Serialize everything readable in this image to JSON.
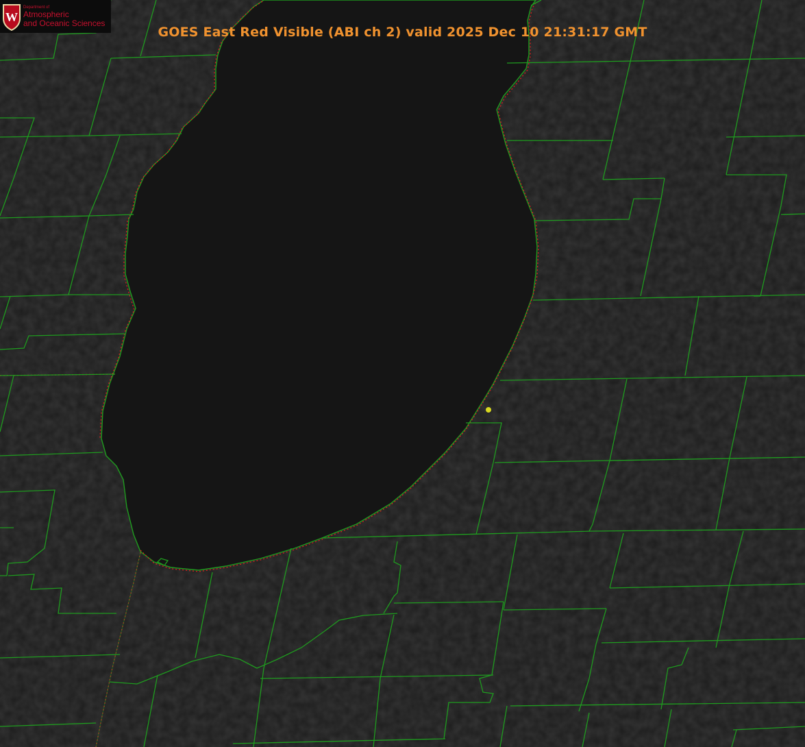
{
  "title": "GOES East Red Visible (ABI ch 2) valid 2025 Dec 10 21:31:17 GMT",
  "logo": {
    "line1": "Department of",
    "line2": "Atmospheric",
    "line3": "and Oceanic Sciences",
    "crest_letter": "W"
  },
  "colors": {
    "county_lines": "#1f9c1f",
    "state_border": "#d11f1f",
    "title": "#f0922f",
    "marker": "#d8d820",
    "logo_text": "#c8102e"
  },
  "icons": {
    "marker": "location-dot-icon",
    "crest": "uw-crest-icon"
  }
}
